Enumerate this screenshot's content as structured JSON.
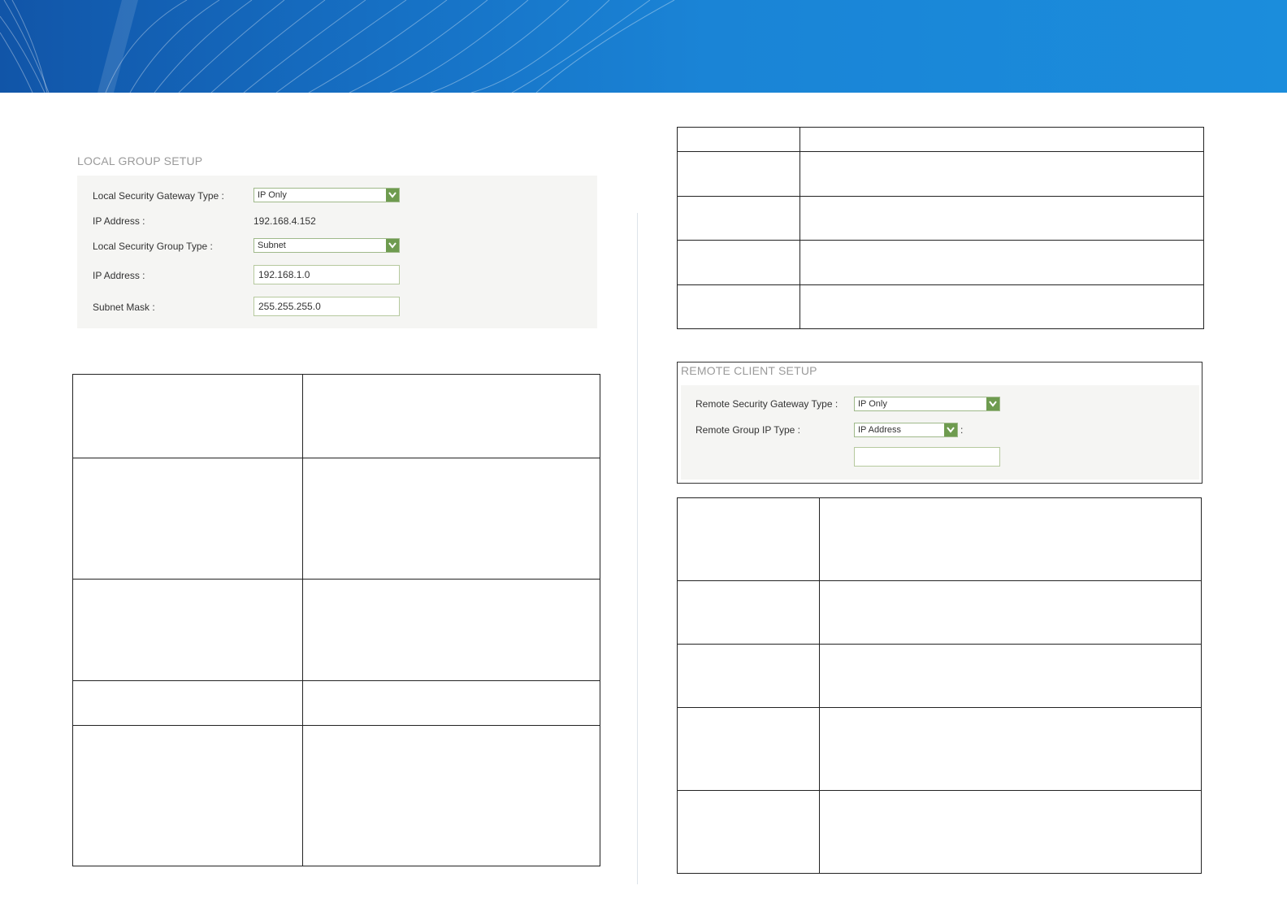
{
  "local_group_setup": {
    "title": "LOCAL GROUP SETUP",
    "rows": [
      {
        "label": "Local Security Gateway Type :",
        "select": "IP Only"
      },
      {
        "label": "IP Address :",
        "value": "192.168.4.152"
      },
      {
        "label": "Local Security Group Type :",
        "select": "Subnet"
      },
      {
        "label": "IP Address :",
        "input": "192.168.1.0"
      },
      {
        "label": "Subnet Mask :",
        "input": "255.255.255.0"
      }
    ]
  },
  "remote_client_setup": {
    "title": "REMOTE CLIENT SETUP",
    "rows": [
      {
        "label": "Remote Security Gateway Type :",
        "select": "IP Only"
      },
      {
        "label": "Remote Group IP Type :",
        "select": "IP Address",
        "suffix": ":"
      },
      {
        "label": "",
        "input": ""
      }
    ]
  },
  "colors": {
    "banner": "#1670c4",
    "panel_bg": "#f5f5f3",
    "select_border": "#9fb98a",
    "select_arrow": "#6e9b4f"
  }
}
